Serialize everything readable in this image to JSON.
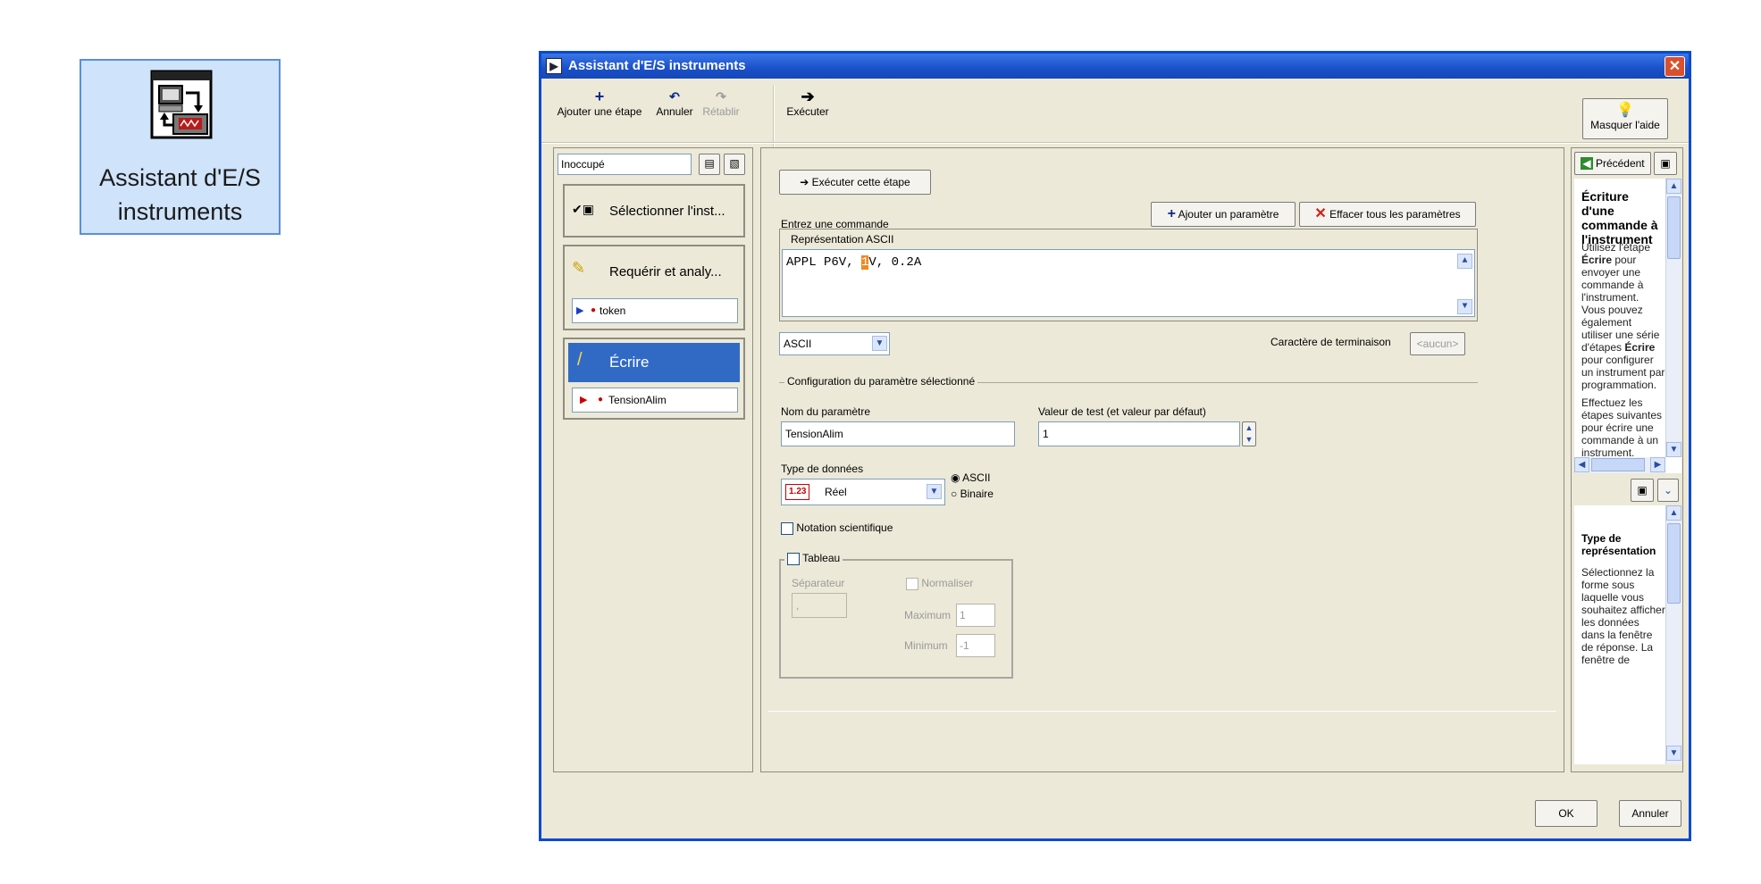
{
  "desktop_icon": {
    "label_line1": "Assistant d'E/S",
    "label_line2": "instruments"
  },
  "window": {
    "title": "Assistant d'E/S instruments",
    "close_glyph": "✕"
  },
  "toolbar": {
    "add_step_label": "Ajouter une étape",
    "undo_label": "Annuler",
    "redo_label": "Rétablir",
    "execute_label": "Exécuter",
    "hide_help_label": "Masquer l'aide"
  },
  "steps_panel": {
    "status": "Inoccupé",
    "steps": [
      {
        "label": "Sélectionner l'inst...",
        "icon": "instrument-icon"
      },
      {
        "label": "Requérir et analy...",
        "icon": "query-icon",
        "sub": "token"
      },
      {
        "label": "Écrire",
        "icon": "write-icon",
        "sub": "TensionAlim",
        "selected": true
      }
    ]
  },
  "main_panel": {
    "run_step_label": "Exécuter cette étape",
    "command_label": "Entrez une commande",
    "add_param_label": "Ajouter un paramètre",
    "clear_params_label": "Effacer tous les paramètres",
    "representation_tab": "Représentation ASCII",
    "command_before": "APPL P6V, ",
    "command_highlight": "1",
    "command_after": "V, 0.2A",
    "format_select": "ASCII",
    "termination_label": "Caractère de terminaison",
    "termination_value": "<aucun>",
    "config_group_label": "Configuration du paramètre sélectionné",
    "param_name_label": "Nom du paramètre",
    "param_name_value": "TensionAlim",
    "test_value_label": "Valeur de test (et valeur par défaut)",
    "test_value": "1",
    "data_type_label": "Type de données",
    "data_type_badge": "1.23",
    "data_type_value": "Réel",
    "radio_ascii": "ASCII",
    "radio_binary": "Binaire",
    "sci_notation_label": "Notation scientifique",
    "array_label": "Tableau",
    "separator_label": "Séparateur",
    "separator_value": ",",
    "normalize_label": "Normaliser",
    "maximum_label": "Maximum",
    "maximum_value": "1",
    "minimum_label": "Minimum",
    "minimum_value": "-1"
  },
  "help_panel": {
    "back_label": "Précédent",
    "top_title": "Écriture d'une commande à l'instrument",
    "top_text_1a": "Utilisez l'étape ",
    "top_text_1b": "Écrire",
    "top_text_1c": " pour envoyer une commande à l'instrument. Vous pouvez également utiliser une série d'étapes ",
    "top_text_1d": "Écrire",
    "top_text_1e": " pour configurer un instrument par programmation.",
    "top_text_2": "Effectuez les étapes suivantes pour écrire une commande à un instrument.",
    "bottom_title": "Type de représentation",
    "bottom_text": "Sélectionnez la forme sous laquelle vous souhaitez afficher les données dans la fenêtre de réponse. La fenêtre de"
  },
  "footer": {
    "ok_label": "OK",
    "cancel_label": "Annuler"
  }
}
